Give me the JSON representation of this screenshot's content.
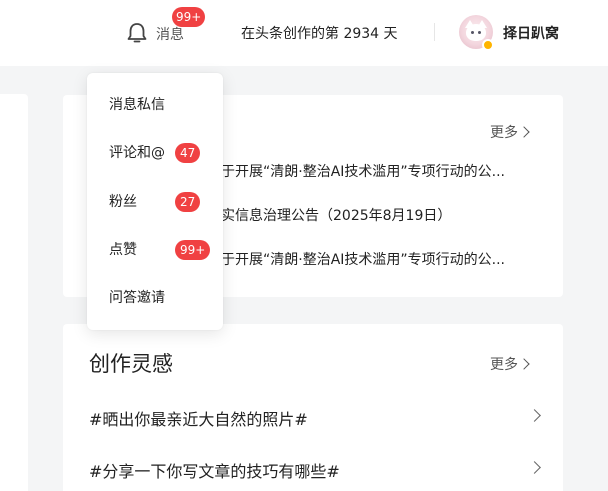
{
  "header": {
    "messages_label": "消息",
    "messages_badge": "99+",
    "creation_days_text": "在头条创作的第 2934 天",
    "username": "择日趴窝"
  },
  "dropdown": {
    "items": [
      {
        "label": "消息私信",
        "badge": ""
      },
      {
        "label": "评论和@",
        "badge": "47"
      },
      {
        "label": "粉丝",
        "badge": "27"
      },
      {
        "label": "点赞",
        "badge": "99+"
      },
      {
        "label": "问答邀请",
        "badge": ""
      }
    ]
  },
  "announcements": {
    "more_label": "更多",
    "items": [
      "于开展“清朗·整治AI技术滥用”专项行动的公...",
      "实信息治理公告（2025年8月19日）",
      "于开展“清朗·整治AI技术滥用”专项行动的公..."
    ]
  },
  "inspiration": {
    "title": "创作灵感",
    "more_label": "更多",
    "topics": [
      "#晒出你最亲近大自然的照片#",
      "#分享一下你写文章的技巧有哪些#"
    ]
  },
  "colors": {
    "badge_red": "#f04142",
    "page_bg": "#f4f5f6",
    "avatar_badge": "#ffb400"
  },
  "icons": [
    "bell-icon",
    "chevron-right-icon",
    "avatar-image"
  ]
}
